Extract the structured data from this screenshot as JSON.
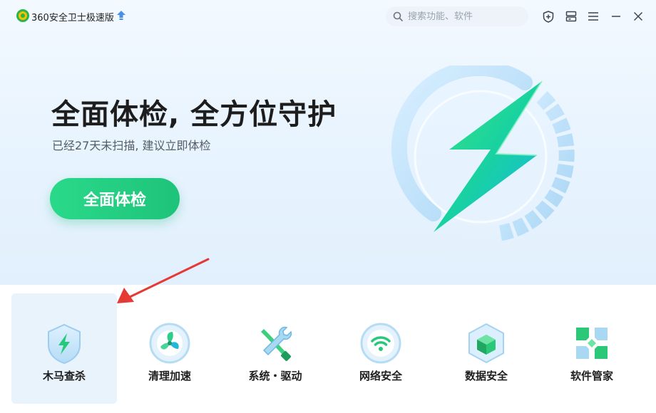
{
  "app": {
    "title": "360安全卫士极速版"
  },
  "search": {
    "placeholder": "搜索功能、软件"
  },
  "window_controls": [
    "shield-icon",
    "layout-icon",
    "menu-icon",
    "minimize-icon",
    "close-icon"
  ],
  "hero": {
    "headline": "全面体检, 全方位守护",
    "subtitle": "已经27天未扫描, 建议立即体检",
    "cta_label": "全面体检"
  },
  "tools": [
    {
      "label": "木马查杀",
      "icon": "trojan-shield-icon",
      "active": true
    },
    {
      "label": "清理加速",
      "icon": "fan-icon",
      "active": false
    },
    {
      "label": "系统・驱动",
      "icon": "wrench-screwdriver-icon",
      "active": false
    },
    {
      "label": "网络安全",
      "icon": "wifi-icon",
      "active": false
    },
    {
      "label": "数据安全",
      "icon": "data-cube-icon",
      "active": false
    },
    {
      "label": "软件管家",
      "icon": "software-grid-icon",
      "active": false
    }
  ],
  "colors": {
    "accent_green": "#1ec37a",
    "hero_bg": "#e7f3fe",
    "active_tile": "#e8f3fc",
    "arrow": "#e53935"
  }
}
